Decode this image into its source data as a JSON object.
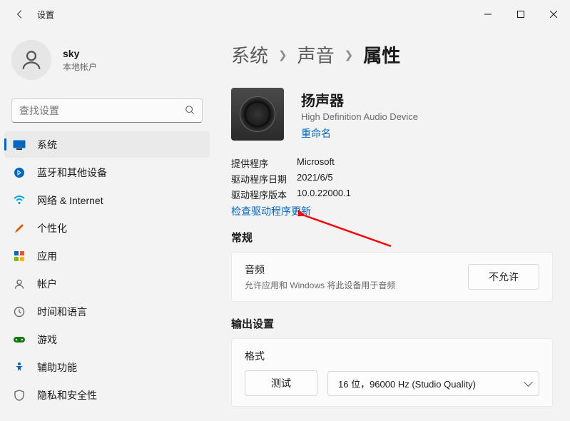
{
  "window": {
    "title": "设置"
  },
  "user": {
    "name": "sky",
    "sub": "本地帐户"
  },
  "search": {
    "placeholder": "查找设置"
  },
  "nav": [
    {
      "label": "系统",
      "icon_color": "#0067c0"
    },
    {
      "label": "蓝牙和其他设备",
      "icon_color": "#0067c0"
    },
    {
      "label": "网络 & Internet",
      "icon_color": "#00a4ef"
    },
    {
      "label": "个性化",
      "icon_color": "#e05a00"
    },
    {
      "label": "应用",
      "icon_color": "#0067c0"
    },
    {
      "label": "帐户",
      "icon_color": "#6a6a6a"
    },
    {
      "label": "时间和语言",
      "icon_color": "#6a6a6a"
    },
    {
      "label": "游戏",
      "icon_color": "#107c10"
    },
    {
      "label": "辅助功能",
      "icon_color": "#0067c0"
    },
    {
      "label": "隐私和安全性",
      "icon_color": "#6a6a6a"
    }
  ],
  "breadcrumb": {
    "a": "系统",
    "b": "声音",
    "c": "属性"
  },
  "device": {
    "name": "扬声器",
    "sub": "High Definition Audio Device",
    "rename": "重命名"
  },
  "meta": {
    "provider_label": "提供程序",
    "provider": "Microsoft",
    "date_label": "驱动程序日期",
    "date": "2021/6/5",
    "ver_label": "驱动程序版本",
    "ver": "10.0.22000.1",
    "check": "检查驱动程序更新"
  },
  "general": {
    "title": "常规",
    "audio_title": "音频",
    "audio_sub": "允许应用和 Windows 将此设备用于音频",
    "deny": "不允许"
  },
  "output": {
    "title": "输出设置",
    "format": "格式",
    "test": "测试",
    "selected": "16 位，96000 Hz (Studio Quality)"
  }
}
